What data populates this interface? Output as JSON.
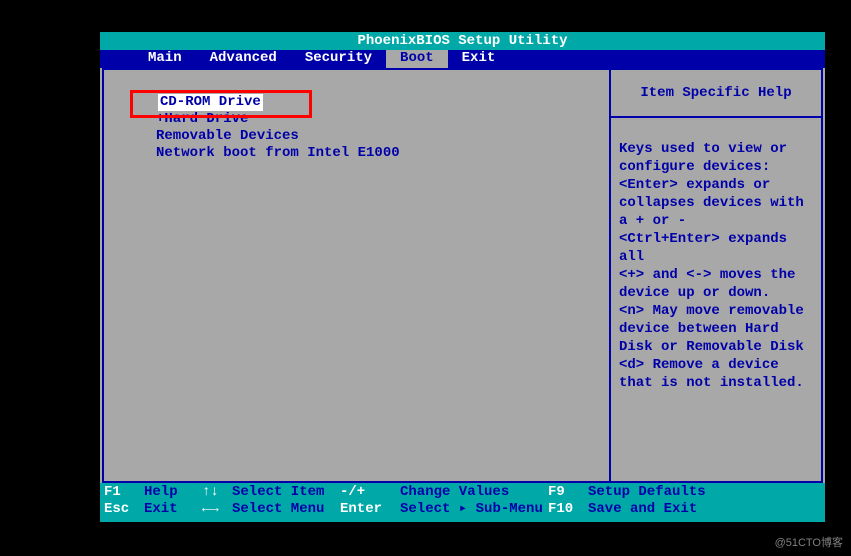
{
  "title": "PhoenixBIOS Setup Utility",
  "menu": {
    "items": [
      "Main",
      "Advanced",
      "Security",
      "Boot",
      "Exit"
    ],
    "active_index": 3
  },
  "boot": {
    "items": [
      {
        "label": "CD-ROM Drive",
        "prefix": "",
        "selected": true
      },
      {
        "label": "+Hard Drive",
        "prefix": "",
        "selected": false
      },
      {
        "label": "Removable Devices",
        "prefix": " ",
        "selected": false
      },
      {
        "label": "Network boot from Intel E1000",
        "prefix": " ",
        "selected": false
      }
    ]
  },
  "help": {
    "header": "Item Specific Help",
    "body_lines": [
      "Keys used to view or",
      "configure devices:",
      "<Enter> expands or",
      "collapses devices with",
      "a + or -",
      "<Ctrl+Enter> expands",
      "all",
      "<+> and <-> moves the",
      "device up or down.",
      "<n> May move removable",
      "device between Hard",
      "Disk or Removable Disk",
      "<d> Remove a device",
      "that is not installed."
    ]
  },
  "footer": {
    "rows": [
      {
        "key": "F1",
        "label": "Help",
        "nav": "↑↓",
        "action1": "Select Item",
        "key2": "-/+",
        "action2": "Change Values",
        "key3": "F9",
        "action3": "Setup Defaults"
      },
      {
        "key": "Esc",
        "label": "Exit",
        "nav": "←→",
        "action1": "Select Menu",
        "key2": "Enter",
        "action2": "Select ▸ Sub-Menu",
        "key3": "F10",
        "action3": "Save and Exit"
      }
    ]
  },
  "watermark": "@51CTO博客"
}
